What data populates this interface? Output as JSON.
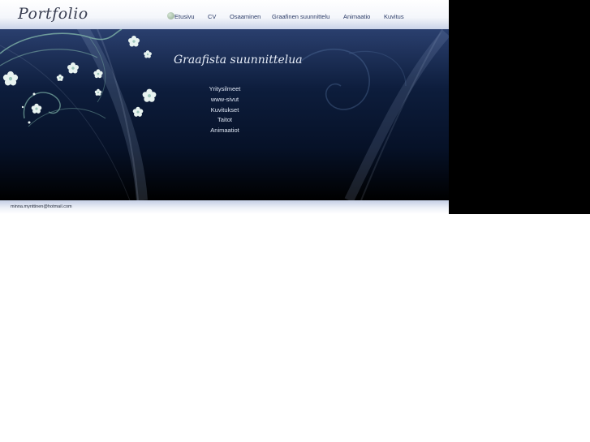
{
  "site": {
    "logo": "Portfolio",
    "nav": [
      {
        "label": "Etusivu",
        "active": true
      },
      {
        "label": "CV"
      },
      {
        "label": "Osaaminen"
      },
      {
        "label": "Graafinen suunnittelu"
      },
      {
        "label": "Animaatio"
      },
      {
        "label": "Kuvitus"
      }
    ],
    "hero": {
      "title": "Graafista suunnittelua",
      "submenu": [
        "Yritysilmeet",
        "www-sivut",
        "Kuvitukset",
        "Taitot",
        "Animaatiot"
      ]
    },
    "footer": {
      "email": "minna.mynttinen@hotmail.com"
    }
  },
  "colors": {
    "nav_text": "#2a3a66",
    "hero_dark": "#061127",
    "hero_light": "#2a3f6e",
    "flower": "#e8f3f0",
    "swirl": "#7fb3a8"
  }
}
